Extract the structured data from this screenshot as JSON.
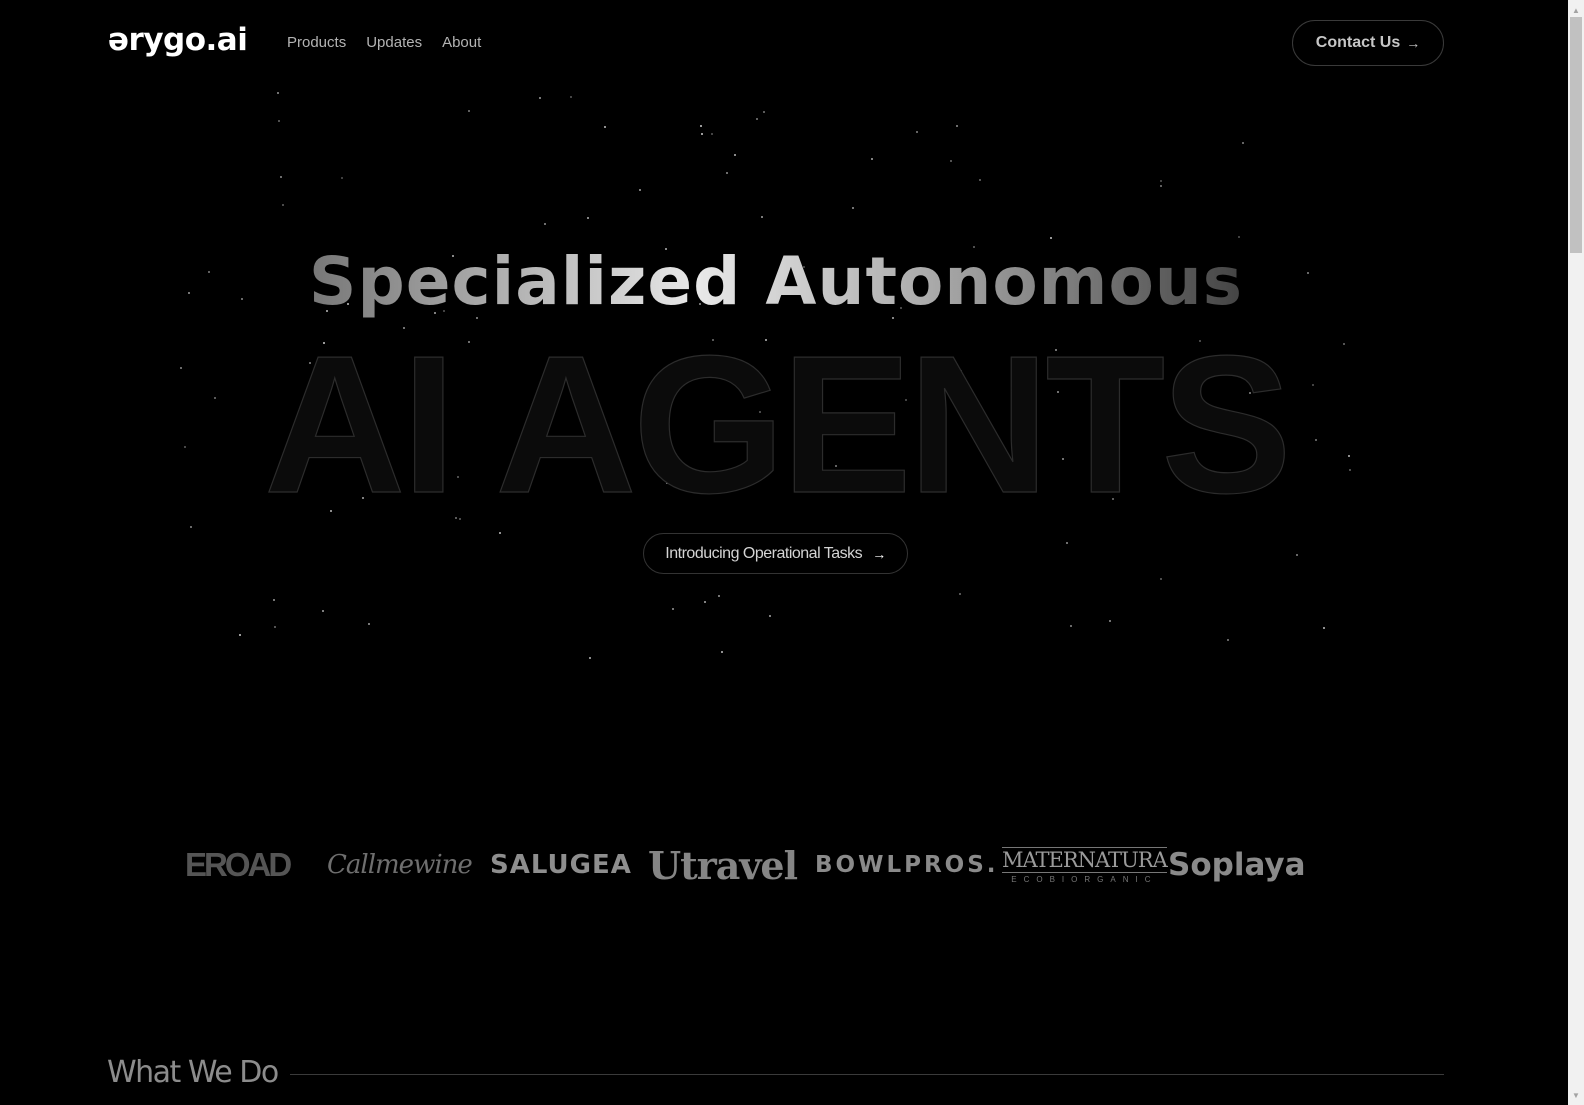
{
  "header": {
    "logo_text": "ərygo.ai",
    "nav": [
      {
        "label": "Products"
      },
      {
        "label": "Updates"
      },
      {
        "label": "About"
      }
    ],
    "contact_button": {
      "label": "Contact Us",
      "icon": "arrow-right-icon",
      "arrow_glyph": "→"
    }
  },
  "hero": {
    "title": "Specialized Autonomous",
    "big_text": "AI AGENTS",
    "pill": {
      "label": "Introducing Operational Tasks",
      "icon": "arrow-right-icon",
      "arrow_glyph": "→"
    }
  },
  "client_logos": [
    {
      "name": "EROAD",
      "text": "EROAD"
    },
    {
      "name": "Callmewine",
      "text": "Callmewine"
    },
    {
      "name": "SALUGEA",
      "text": "SALUGEA"
    },
    {
      "name": "Utravel",
      "text": "Utravel"
    },
    {
      "name": "BOWLPROS.",
      "text": "BOWLPROS."
    },
    {
      "name": "MaterNatura",
      "text": "MATERNATURA",
      "subtext": "ECOBIORGANIC"
    },
    {
      "name": "Soplaya.",
      "text": "Soplaya."
    }
  ],
  "sections": {
    "what_we_do": {
      "title": "What We Do"
    }
  },
  "scrollbar": {
    "up_glyph": "▲",
    "down_glyph": "▼"
  }
}
